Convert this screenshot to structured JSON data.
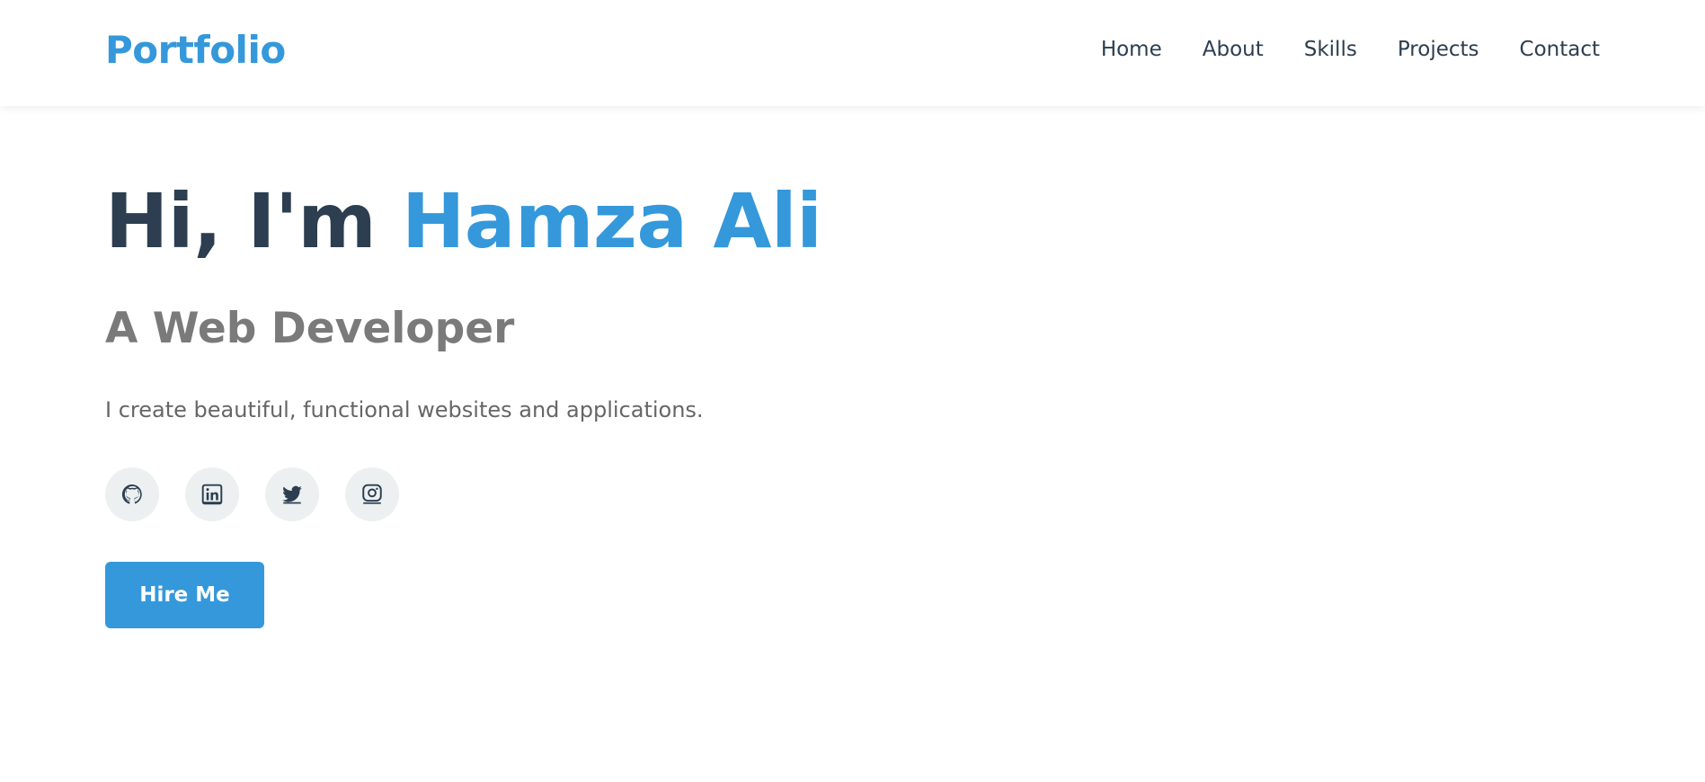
{
  "navbar": {
    "logo": "Portfolio",
    "links": [
      "Home",
      "About",
      "Skills",
      "Projects",
      "Contact"
    ]
  },
  "hero": {
    "greeting": "Hi, I'm",
    "name": "Hamza Ali",
    "subtitle": "A Web Developer",
    "description": "I create beautiful, functional websites and applications.",
    "cta_label": "Hire Me"
  },
  "social": {
    "icons": [
      "github-icon",
      "linkedin-icon",
      "twitter-icon",
      "instagram-icon"
    ]
  },
  "colors": {
    "accent": "#3498db",
    "text_dark": "#2c3e50",
    "text_muted": "#7a7a7a",
    "social_bg": "#ecf0f1"
  }
}
